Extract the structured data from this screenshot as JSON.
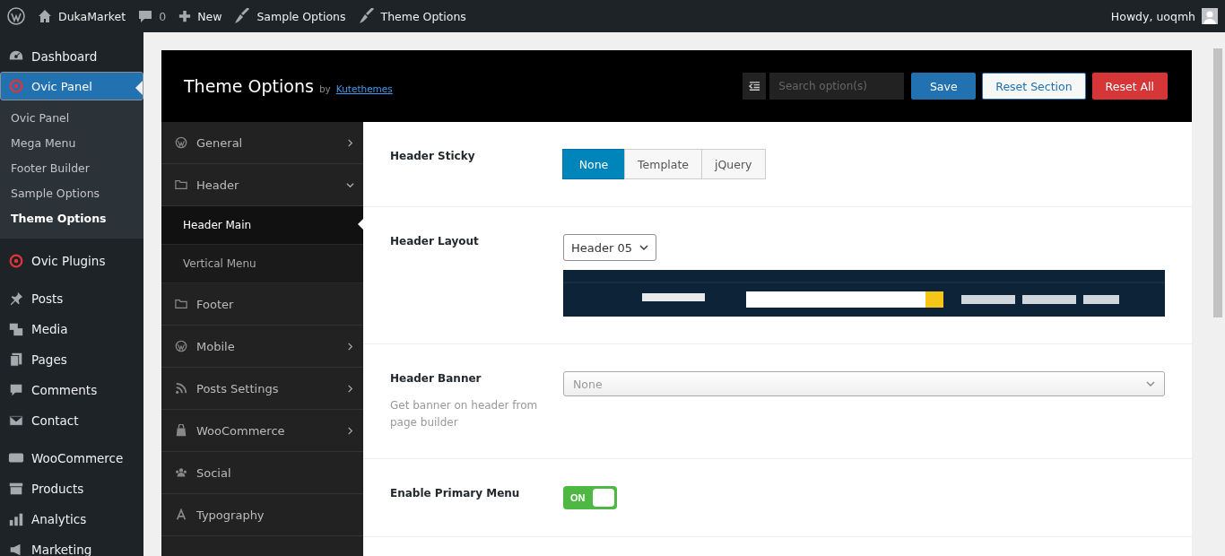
{
  "admin_bar": {
    "site": "DukaMarket",
    "comments": "0",
    "new": "New",
    "items": [
      "Sample Options",
      "Theme Options"
    ],
    "greeting": "Howdy, uoqmh"
  },
  "sidebar": {
    "items": [
      {
        "label": "Dashboard",
        "selected": false
      },
      {
        "label": "Ovic Panel",
        "selected": true,
        "children": [
          {
            "label": "Ovic Panel",
            "selected": false
          },
          {
            "label": "Mega Menu",
            "selected": false
          },
          {
            "label": "Footer Builder",
            "selected": false
          },
          {
            "label": "Sample Options",
            "selected": false
          },
          {
            "label": "Theme Options",
            "selected": true
          }
        ]
      },
      {
        "label": "Ovic Plugins",
        "selected": false
      },
      {
        "label": "Posts",
        "selected": false
      },
      {
        "label": "Media",
        "selected": false
      },
      {
        "label": "Pages",
        "selected": false
      },
      {
        "label": "Comments",
        "selected": false
      },
      {
        "label": "Contact",
        "selected": false
      },
      {
        "label": "WooCommerce",
        "selected": false
      },
      {
        "label": "Products",
        "selected": false
      },
      {
        "label": "Analytics",
        "selected": false
      },
      {
        "label": "Marketing",
        "selected": false
      }
    ]
  },
  "panel": {
    "title": "Theme Options",
    "by": "by",
    "author": "Kutethemes",
    "search": {
      "placeholder": "Search option(s)"
    },
    "buttons": [
      {
        "label": "Save",
        "kind": "primary"
      },
      {
        "label": "Reset Section",
        "kind": "light"
      },
      {
        "label": "Reset All",
        "kind": "danger"
      }
    ]
  },
  "nav": [
    {
      "label": "General",
      "expanded": false,
      "has_children": true
    },
    {
      "label": "Header",
      "expanded": true,
      "has_children": true,
      "children": [
        {
          "label": "Header Main",
          "selected": true
        },
        {
          "label": "Vertical Menu",
          "selected": false
        }
      ]
    },
    {
      "label": "Footer",
      "has_children": false
    },
    {
      "label": "Mobile",
      "expanded": false,
      "has_children": true
    },
    {
      "label": "Posts Settings",
      "expanded": false,
      "has_children": true
    },
    {
      "label": "WooCommerce",
      "expanded": false,
      "has_children": true
    },
    {
      "label": "Social",
      "has_children": false
    },
    {
      "label": "Typography",
      "has_children": false
    }
  ],
  "fields": [
    {
      "kind": "buttonset",
      "label": "Header Sticky",
      "options": [
        {
          "label": "None",
          "selected": true
        },
        {
          "label": "Template",
          "selected": false
        },
        {
          "label": "jQuery",
          "selected": false
        }
      ]
    },
    {
      "kind": "image_select",
      "label": "Header Layout",
      "value": "Header 05"
    },
    {
      "kind": "select2",
      "label": "Header Banner",
      "value": "None",
      "description": "Get banner on header from page builder"
    },
    {
      "kind": "switch",
      "label": "Enable Primary Menu",
      "on": true,
      "on_label": "ON"
    }
  ]
}
